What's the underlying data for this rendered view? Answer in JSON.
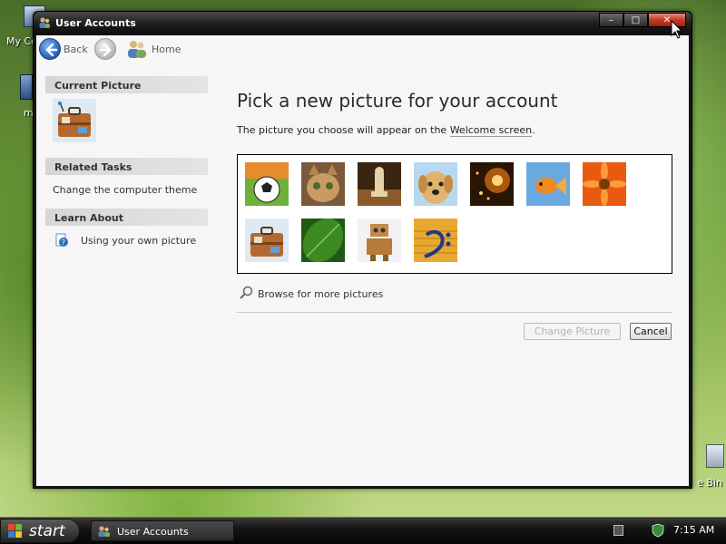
{
  "desktop": {
    "icons": [
      {
        "label": "My Co"
      },
      {
        "label": "m"
      },
      {
        "label": "e Bin"
      }
    ]
  },
  "window": {
    "title": "User Accounts",
    "controls": {
      "minimize": "–",
      "maximize": "□",
      "close": "✕"
    }
  },
  "nav": {
    "back_label": "Back",
    "home_label": "Home"
  },
  "side": {
    "current_picture_heading": "Current Picture",
    "related_tasks_heading": "Related Tasks",
    "related_tasks": [
      "Change the computer theme"
    ],
    "learn_about_heading": "Learn About",
    "learn_about": [
      "Using your own picture"
    ]
  },
  "main": {
    "title": "Pick a new picture for your account",
    "desc_before": "The picture you choose will appear on the ",
    "desc_link": "Welcome screen",
    "desc_after": ".",
    "pictures": [
      {
        "name": "soccer-ball"
      },
      {
        "name": "kitten"
      },
      {
        "name": "chess"
      },
      {
        "name": "dog"
      },
      {
        "name": "sparkles"
      },
      {
        "name": "goldfish"
      },
      {
        "name": "flower"
      },
      {
        "name": "suitcase"
      },
      {
        "name": "leaf"
      },
      {
        "name": "robot"
      },
      {
        "name": "music-clef"
      }
    ],
    "browse_label": "Browse for more pictures",
    "change_button": "Change Picture",
    "cancel_button": "Cancel"
  },
  "taskbar": {
    "start_label": "start",
    "task_label": "User Accounts",
    "time": "7:15 AM"
  },
  "colors": {
    "close_button": "#c33b26",
    "title_bar": "#1e1e1e",
    "client_bg": "#f6f6f6",
    "side_heading_bg": "#d6d6d6"
  }
}
